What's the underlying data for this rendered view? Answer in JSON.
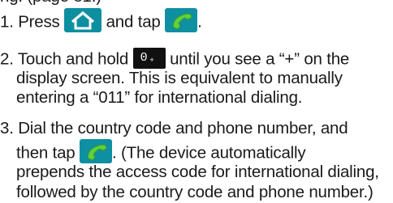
{
  "colors": {
    "text": "#1a1a1a",
    "icon_teal": "#0d8fa0",
    "phone_green": "#5fd13a",
    "key_black": "#111111"
  },
  "icons": {
    "home": "home-icon",
    "phone": "phone-icon",
    "zero_key": "zero-key-icon"
  },
  "top_fragment": "ng. (page 81.)",
  "steps": [
    {
      "num": "1.",
      "parts": [
        "Press",
        "and tap",
        "."
      ]
    },
    {
      "num": "2.",
      "parts": [
        "Touch and hold",
        "until you see a “+” on the"
      ],
      "key_digit": "0",
      "key_sub": "+",
      "cont": [
        "display screen. This is equivalent to manually",
        "entering a “011” for international dialing."
      ]
    },
    {
      "num": "3.",
      "first": "Dial the country code and phone number, and",
      "parts": [
        "then tap",
        ". (The device automatically"
      ],
      "cont": [
        "prepends the access code for international dialing,",
        "followed by the country code and phone number.)"
      ]
    }
  ]
}
